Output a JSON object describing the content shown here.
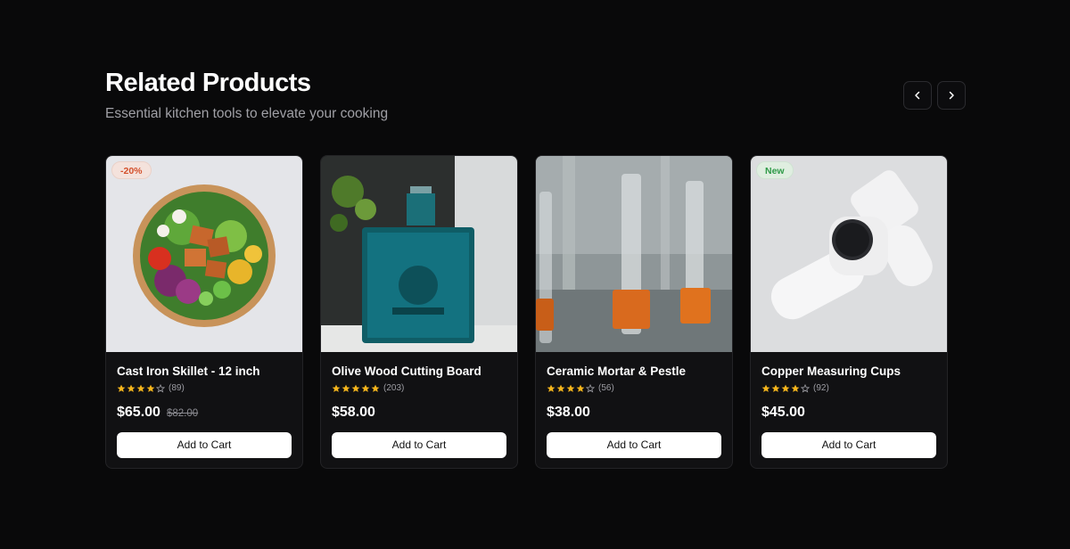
{
  "section": {
    "title": "Related Products",
    "subtitle": "Essential kitchen tools to elevate your cooking"
  },
  "nav": {
    "prev_icon": "chevron-left-icon",
    "next_icon": "chevron-right-icon"
  },
  "colors": {
    "background": "#09090a",
    "card": "#111113",
    "star": "#f5b51c",
    "sale_badge_text": "#d3502c",
    "new_badge_text": "#2f9a48"
  },
  "products": [
    {
      "name": "Cast Iron Skillet - 12 inch",
      "badge": "-20%",
      "badge_type": "sale",
      "rating": 4,
      "reviews": "(89)",
      "price": "$65.00",
      "original_price": "$82.00",
      "button": "Add to Cart",
      "image": "salad-bowl-photo"
    },
    {
      "name": "Olive Wood Cutting Board",
      "badge": "",
      "badge_type": "new",
      "rating": 5,
      "reviews": "(203)",
      "price": "$58.00",
      "original_price": "",
      "button": "Add to Cart",
      "image": "cologne-bottle-photo"
    },
    {
      "name": "Ceramic Mortar & Pestle",
      "badge": "",
      "badge_type": "",
      "rating": 4,
      "reviews": "(56)",
      "price": "$38.00",
      "original_price": "",
      "button": "Add to Cart",
      "image": "glass-vials-photo"
    },
    {
      "name": "Copper Measuring Cups",
      "badge": "New",
      "badge_type": "new",
      "rating": 4,
      "reviews": "(92)",
      "price": "$45.00",
      "original_price": "",
      "button": "Add to Cart",
      "image": "smartwatch-photo"
    }
  ]
}
